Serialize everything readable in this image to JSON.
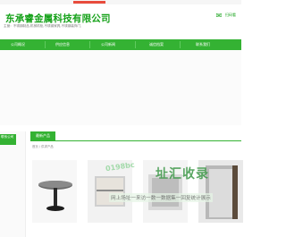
{
  "topbar": {
    "welcome": "",
    "badge": ""
  },
  "header": {
    "company_name": "东承睿金属科技有限公司",
    "main_business": "主营：不锈钢制品,机械机柜,不锈钢家具,不锈钢装饰门,",
    "wechat_label": "扫码看"
  },
  "nav": {
    "items": [
      "公司概况",
      "供应信息",
      "公司新闻",
      "诚信档案",
      "联系我们"
    ]
  },
  "sidebar": {
    "heading": "联系公司",
    "lines": [
      "",
      "",
      "",
      "",
      "",
      "",
      ""
    ]
  },
  "main": {
    "section_title": "最新产品",
    "breadcrumb": "首页 / 供求产品"
  },
  "watermark": {
    "small": "0198bc",
    "big": "址汇收录",
    "sub": "网上场址一来访一数一数据集一回复统计展示"
  },
  "colors": {
    "brand_green": "#34b233",
    "title_green": "#16a21a"
  }
}
